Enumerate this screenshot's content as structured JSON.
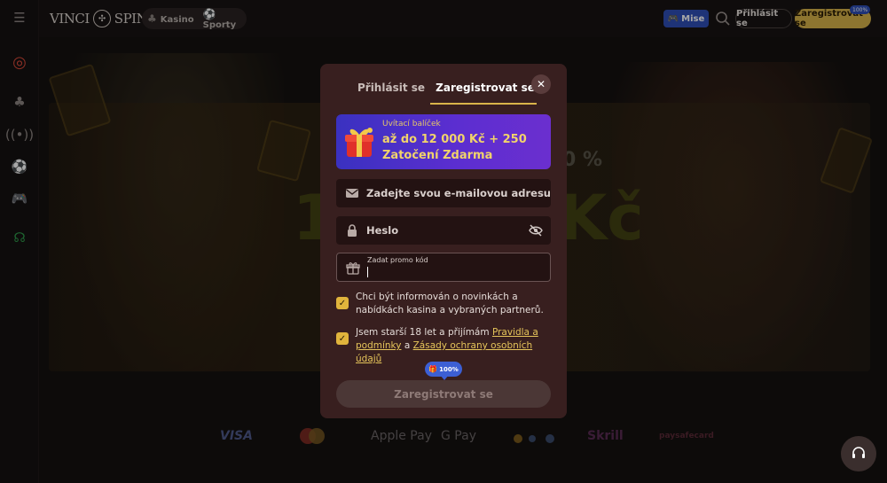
{
  "header": {
    "logo_left": "VINCI",
    "logo_right": "SPIN",
    "nav": [
      {
        "label": "Kasino",
        "icon": "cherries-icon"
      },
      {
        "label": "Sporty",
        "icon": "soccer-ball-icon"
      }
    ],
    "mise_label": "Mise",
    "login_label": "Přihlásit se",
    "register_label": "Zaregistrovat se",
    "register_badge": "100%"
  },
  "sidebar": {
    "icons": [
      "menu-icon",
      "slots-icon",
      "cherries-icon",
      "live-icon",
      "sports-ball-icon",
      "gamepad-icon",
      "responsible-gaming-icon"
    ]
  },
  "banner": {
    "ghost_percent": "0 %",
    "ghost_big_left": "1",
    "ghost_big_right": "Kč"
  },
  "modal": {
    "tab_login": "Přihlásit se",
    "tab_register": "Zaregistrovat se",
    "promo_title": "Uvítací balíček",
    "promo_text": "až do 12 000 Kč + 250 Zatočení Zdarma",
    "email_placeholder": "Zadejte svou e-mailovou adresu",
    "password_placeholder": "Heslo",
    "promo_code_label": "Zadat promo kód",
    "checkbox_news": "Chci být informován o novinkách a nabídkách kasina a vybraných partnerů.",
    "checkbox_terms_prefix": "Jsem starší 18 let a přijímám",
    "terms_link": "Pravidla a podmínky",
    "terms_and": "a",
    "privacy_link": "Zásady ochrany osobních údajů",
    "progress_badge": "100%",
    "submit_label": "Zaregistrovat se"
  },
  "payments": [
    "VISA",
    "Apple Pay",
    "G Pay",
    "Skrill",
    "paysafecard"
  ],
  "colors": {
    "accent_gold": "#d9b44a",
    "mise_blue": "#2e4fb7",
    "modal_bg": "#381f1f",
    "promo_purple": "#5b2ed0"
  }
}
